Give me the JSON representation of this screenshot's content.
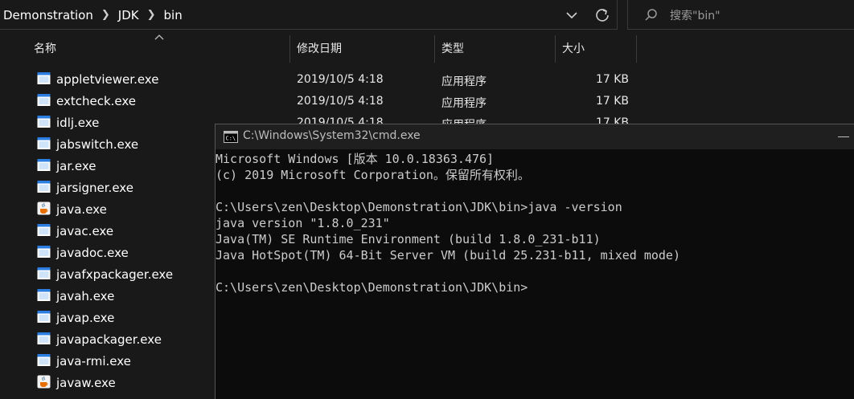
{
  "explorer": {
    "breadcrumb": [
      "Demonstration",
      "JDK",
      "bin"
    ],
    "search": {
      "placeholder": "搜索\"bin\""
    },
    "columns": {
      "name": "名称",
      "date": "修改日期",
      "type": "类型",
      "size": "大小"
    },
    "files": [
      {
        "name": "appletviewer.exe",
        "date": "2019/10/5 4:18",
        "type": "应用程序",
        "size": "17 KB",
        "icon": "exe-window-icon"
      },
      {
        "name": "extcheck.exe",
        "date": "2019/10/5 4:18",
        "type": "应用程序",
        "size": "17 KB",
        "icon": "exe-window-icon"
      },
      {
        "name": "idlj.exe",
        "date": "2019/10/5 4:18",
        "type": "应用程序",
        "size": "17 KB",
        "icon": "exe-window-icon"
      },
      {
        "name": "jabswitch.exe",
        "icon": "exe-window-icon"
      },
      {
        "name": "jar.exe",
        "icon": "exe-window-icon"
      },
      {
        "name": "jarsigner.exe",
        "icon": "exe-window-icon"
      },
      {
        "name": "java.exe",
        "icon": "java-coffee-icon"
      },
      {
        "name": "javac.exe",
        "icon": "exe-window-icon"
      },
      {
        "name": "javadoc.exe",
        "icon": "exe-window-icon"
      },
      {
        "name": "javafxpackager.exe",
        "icon": "exe-window-icon"
      },
      {
        "name": "javah.exe",
        "icon": "exe-window-icon"
      },
      {
        "name": "javap.exe",
        "icon": "exe-window-icon"
      },
      {
        "name": "javapackager.exe",
        "icon": "exe-window-icon"
      },
      {
        "name": "java-rmi.exe",
        "icon": "exe-window-icon"
      },
      {
        "name": "javaw.exe",
        "icon": "java-coffee-icon"
      }
    ]
  },
  "cmd": {
    "title": "C:\\Windows\\System32\\cmd.exe",
    "lines": [
      "Microsoft Windows [版本 10.0.18363.476]",
      "(c) 2019 Microsoft Corporation。保留所有权利。",
      "",
      "C:\\Users\\zen\\Desktop\\Demonstration\\JDK\\bin>java -version",
      "java version \"1.8.0_231\"",
      "Java(TM) SE Runtime Environment (build 1.8.0_231-b11)",
      "Java HotSpot(TM) 64-Bit Server VM (build 25.231-b11, mixed mode)",
      "",
      "C:\\Users\\zen\\Desktop\\Demonstration\\JDK\\bin>"
    ]
  },
  "colors": {
    "background": "#191919",
    "terminal_bg": "#0c0c0c",
    "terminal_text": "#cccccc"
  }
}
